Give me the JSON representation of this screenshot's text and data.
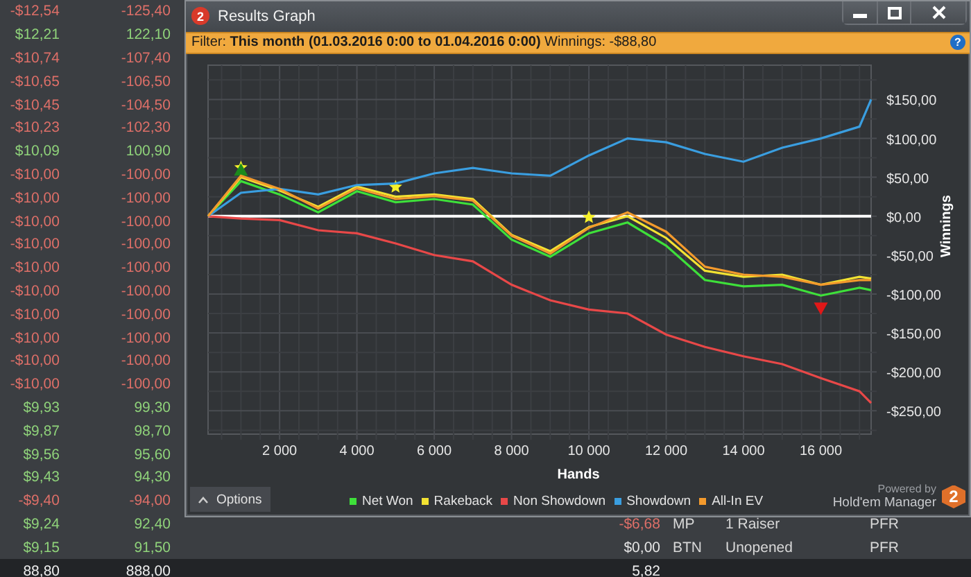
{
  "table": {
    "rows": [
      {
        "amount": "-$12,54",
        "value": "-125,40",
        "color": "#dd6f68"
      },
      {
        "amount": "$12,21",
        "value": "122,10",
        "color": "#8fd27a"
      },
      {
        "amount": "-$10,74",
        "value": "-107,40",
        "color": "#dd6f68"
      },
      {
        "amount": "-$10,65",
        "value": "-106,50",
        "color": "#dd6f68"
      },
      {
        "amount": "-$10,45",
        "value": "-104,50",
        "color": "#dd6f68"
      },
      {
        "amount": "-$10,23",
        "value": "-102,30",
        "color": "#dd6f68"
      },
      {
        "amount": "$10,09",
        "value": "100,90",
        "color": "#8fd27a"
      },
      {
        "amount": "-$10,00",
        "value": "-100,00",
        "color": "#dd6f68"
      },
      {
        "amount": "-$10,00",
        "value": "-100,00",
        "color": "#dd6f68"
      },
      {
        "amount": "-$10,00",
        "value": "-100,00",
        "color": "#dd6f68"
      },
      {
        "amount": "-$10,00",
        "value": "-100,00",
        "color": "#dd6f68"
      },
      {
        "amount": "-$10,00",
        "value": "-100,00",
        "color": "#dd6f68"
      },
      {
        "amount": "-$10,00",
        "value": "-100,00",
        "color": "#dd6f68"
      },
      {
        "amount": "-$10,00",
        "value": "-100,00",
        "color": "#dd6f68"
      },
      {
        "amount": "-$10,00",
        "value": "-100,00",
        "color": "#dd6f68"
      },
      {
        "amount": "-$10,00",
        "value": "-100,00",
        "color": "#dd6f68"
      },
      {
        "amount": "-$10,00",
        "value": "-100,00",
        "color": "#dd6f68"
      },
      {
        "amount": "$9,93",
        "value": "99,30",
        "color": "#8fd27a"
      },
      {
        "amount": "$9,87",
        "value": "98,70",
        "color": "#8fd27a"
      },
      {
        "amount": "$9,56",
        "value": "95,60",
        "color": "#8fd27a"
      },
      {
        "amount": "$9,43",
        "value": "94,30",
        "color": "#8fd27a"
      },
      {
        "amount": "-$9,40",
        "value": "-94,00",
        "color": "#dd6f68"
      },
      {
        "amount": "$9,24",
        "value": "92,40",
        "color": "#8fd27a",
        "extra": {
          "amount": "-$6,68",
          "color": "#dd6f68",
          "position": "MP",
          "situation": "1 Raiser",
          "action": "PFR"
        }
      },
      {
        "amount": "$9,15",
        "value": "91,50",
        "color": "#8fd27a",
        "extra": {
          "amount": "$0,00",
          "color": "#e4e4e4",
          "position": "BTN",
          "situation": "Unopened",
          "action": "PFR"
        }
      }
    ],
    "totals": {
      "amount": "88,80",
      "value": "888,00",
      "column_3": "5,82"
    }
  },
  "window": {
    "logo": "2",
    "title": "Results Graph",
    "filter": "Filter: **This month (01.03.2016 0:00 to 01.04.2016 0:00)** Winnings: -$88,80",
    "help": "?",
    "chart_data": {
      "type": "line",
      "xlabel": "Hands",
      "ylabel": "Winnings",
      "grid": true,
      "x": [
        150,
        1000,
        2000,
        3000,
        4000,
        5000,
        6000,
        7000,
        8000,
        9000,
        10000,
        11000,
        12000,
        13000,
        14000,
        15000,
        16000,
        17000,
        17300
      ],
      "series": [
        {
          "name": "Net Won",
          "color": "#3ee03a",
          "values": [
            0,
            45,
            28,
            5,
            32,
            18,
            22,
            15,
            -30,
            -52,
            -22,
            -8,
            -38,
            -82,
            -90,
            -88,
            -102,
            -92,
            -95
          ]
        },
        {
          "name": "Rakeback",
          "color": "#f2e232",
          "values": [
            0,
            50,
            33,
            12,
            38,
            25,
            28,
            22,
            -24,
            -45,
            -14,
            0,
            -28,
            -70,
            -78,
            -75,
            -88,
            -78,
            -80
          ]
        },
        {
          "name": "Non Showdown",
          "color": "#e84848",
          "values": [
            0,
            -3,
            -5,
            -18,
            -22,
            -35,
            -50,
            -58,
            -88,
            -108,
            -120,
            -125,
            -152,
            -168,
            -180,
            -190,
            -208,
            -225,
            -240
          ]
        },
        {
          "name": "Showdown",
          "color": "#3a9ee0",
          "values": [
            0,
            30,
            35,
            28,
            40,
            42,
            55,
            62,
            55,
            52,
            78,
            100,
            95,
            80,
            70,
            88,
            100,
            115,
            150
          ]
        },
        {
          "name": "All-In EV",
          "color": "#f39a2c",
          "values": [
            0,
            52,
            35,
            10,
            36,
            22,
            26,
            20,
            -25,
            -48,
            -15,
            5,
            -20,
            -65,
            -75,
            -78,
            -88,
            -82,
            -82
          ]
        }
      ],
      "xlim": [
        150,
        17300
      ],
      "ylim": [
        -280,
        194
      ],
      "xticks": [
        {
          "value": 2000,
          "label": "2 000"
        },
        {
          "value": 4000,
          "label": "4 000"
        },
        {
          "value": 6000,
          "label": "6 000"
        },
        {
          "value": 8000,
          "label": "8 000"
        },
        {
          "value": 10000,
          "label": "10 000"
        },
        {
          "value": 12000,
          "label": "12 000"
        },
        {
          "value": 14000,
          "label": "14 000"
        },
        {
          "value": 16000,
          "label": "16 000"
        }
      ],
      "yticks": [
        {
          "value": 150,
          "label": "$150,00"
        },
        {
          "value": 100,
          "label": "$100,00"
        },
        {
          "value": 50,
          "label": "$50,00"
        },
        {
          "value": 0,
          "label": "$0,00"
        },
        {
          "value": -50,
          "label": "-$50,00"
        },
        {
          "value": -100,
          "label": "-$100,00"
        },
        {
          "value": -150,
          "label": "-$150,00"
        },
        {
          "value": -200,
          "label": "-$200,00"
        },
        {
          "value": -250,
          "label": "-$250,00"
        }
      ]
    },
    "options_button": "Options",
    "powered_by": "Powered by",
    "brand": "Hold'em Manager",
    "brand_logo": "2"
  }
}
